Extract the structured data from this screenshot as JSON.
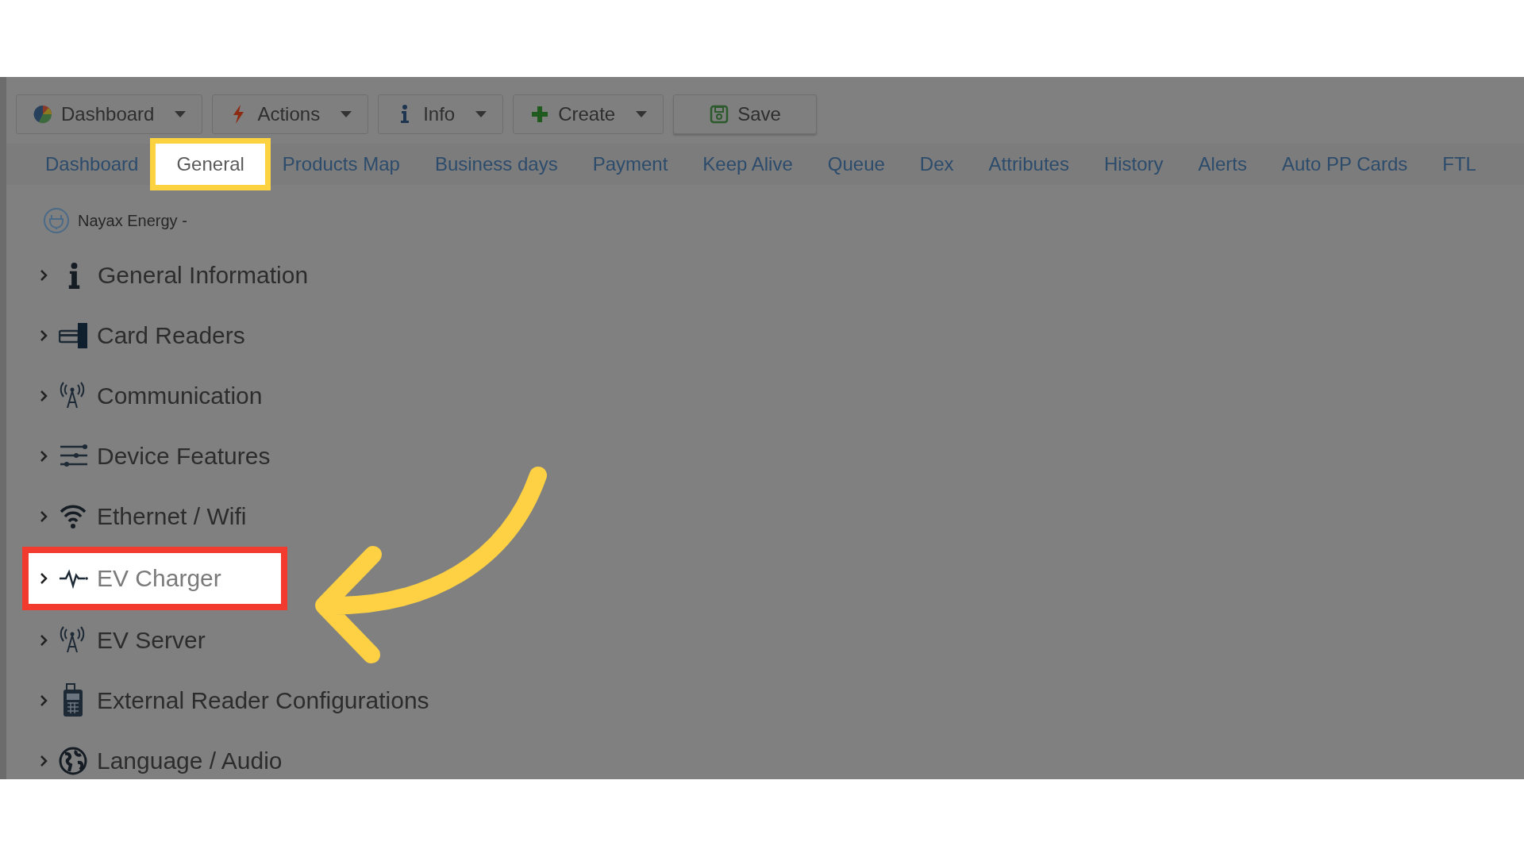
{
  "toolbar": [
    {
      "label": "Dashboard",
      "dropdown": true
    },
    {
      "label": "Actions",
      "dropdown": true
    },
    {
      "label": "Info",
      "dropdown": true
    },
    {
      "label": "Create",
      "dropdown": true
    },
    {
      "label": "Save",
      "dropdown": false
    }
  ],
  "tabs": [
    {
      "label": "Dashboard",
      "selected": false,
      "highlighted": false
    },
    {
      "label": "General",
      "selected": true,
      "highlighted": true
    },
    {
      "label": "Products Map",
      "selected": false,
      "highlighted": false
    },
    {
      "label": "Business days",
      "selected": false,
      "highlighted": false
    },
    {
      "label": "Payment",
      "selected": false,
      "highlighted": false
    },
    {
      "label": "Keep Alive",
      "selected": false,
      "highlighted": false
    },
    {
      "label": "Queue",
      "selected": false,
      "highlighted": false
    },
    {
      "label": "Dex",
      "selected": false,
      "highlighted": false
    },
    {
      "label": "Attributes",
      "selected": false,
      "highlighted": false
    },
    {
      "label": "History",
      "selected": false,
      "highlighted": false
    },
    {
      "label": "Alerts",
      "selected": false,
      "highlighted": false
    },
    {
      "label": "Auto PP Cards",
      "selected": false,
      "highlighted": false
    },
    {
      "label": "FTL",
      "selected": false,
      "highlighted": false
    }
  ],
  "device": {
    "title": "Nayax Energy -"
  },
  "sections": [
    {
      "label": "General Information",
      "expanded": false,
      "highlighted": false
    },
    {
      "label": "Card Readers",
      "expanded": false,
      "highlighted": false
    },
    {
      "label": "Communication",
      "expanded": false,
      "highlighted": false
    },
    {
      "label": "Device Features",
      "expanded": false,
      "highlighted": false
    },
    {
      "label": "Ethernet / Wifi",
      "expanded": false,
      "highlighted": false
    },
    {
      "label": "EV Charger",
      "expanded": false,
      "highlighted": true
    },
    {
      "label": "EV Server",
      "expanded": false,
      "highlighted": false
    },
    {
      "label": "External Reader Configurations",
      "expanded": false,
      "highlighted": false
    },
    {
      "label": "Language / Audio",
      "expanded": false,
      "highlighted": false
    }
  ]
}
